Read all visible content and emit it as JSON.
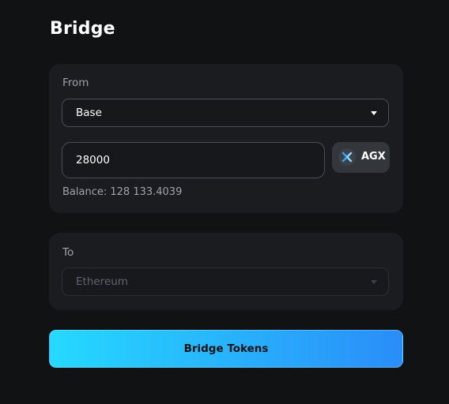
{
  "page": {
    "title": "Bridge"
  },
  "from": {
    "label": "From",
    "network": "Base",
    "amount": "28000",
    "token": "AGX",
    "balance_label": "Balance:",
    "balance_value": "128 133.4039"
  },
  "to": {
    "label": "To",
    "network": "Ethereum"
  },
  "actions": {
    "bridge_label": "Bridge Tokens"
  },
  "icons": {
    "network_dropdown": "caret-down-icon",
    "token_logo": "agx-logo-icon"
  },
  "colors": {
    "background": "#111214",
    "card": "#1b1c1f",
    "button_gradient_start": "#26d9ff",
    "button_gradient_end": "#2a8df9"
  }
}
